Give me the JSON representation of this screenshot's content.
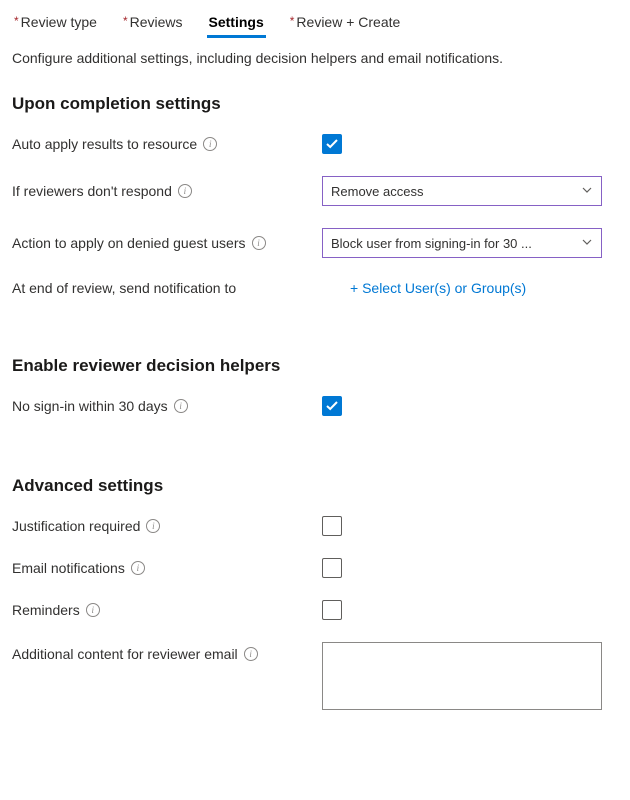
{
  "tabs": {
    "review_type": "Review type",
    "reviews": "Reviews",
    "settings": "Settings",
    "review_create": "Review + Create"
  },
  "intro": "Configure additional settings, including decision helpers and email notifications.",
  "sections": {
    "completion": "Upon completion settings",
    "helpers": "Enable reviewer decision helpers",
    "advanced": "Advanced settings"
  },
  "labels": {
    "auto_apply": "Auto apply results to resource",
    "no_respond": "If reviewers don't respond",
    "denied_guest": "Action to apply on denied guest users",
    "end_notify": "At end of review, send notification to",
    "no_signin": "No sign-in within 30 days",
    "justification": "Justification required",
    "email_notif": "Email notifications",
    "reminders": "Reminders",
    "additional_content": "Additional content for reviewer email"
  },
  "controls": {
    "no_respond_value": "Remove access",
    "denied_guest_value": "Block user from signing-in for 30 ...",
    "select_users_link": "+ Select User(s) or Group(s)",
    "auto_apply_checked": true,
    "no_signin_checked": true,
    "justification_checked": false,
    "email_notif_checked": false,
    "reminders_checked": false,
    "additional_content_value": ""
  }
}
